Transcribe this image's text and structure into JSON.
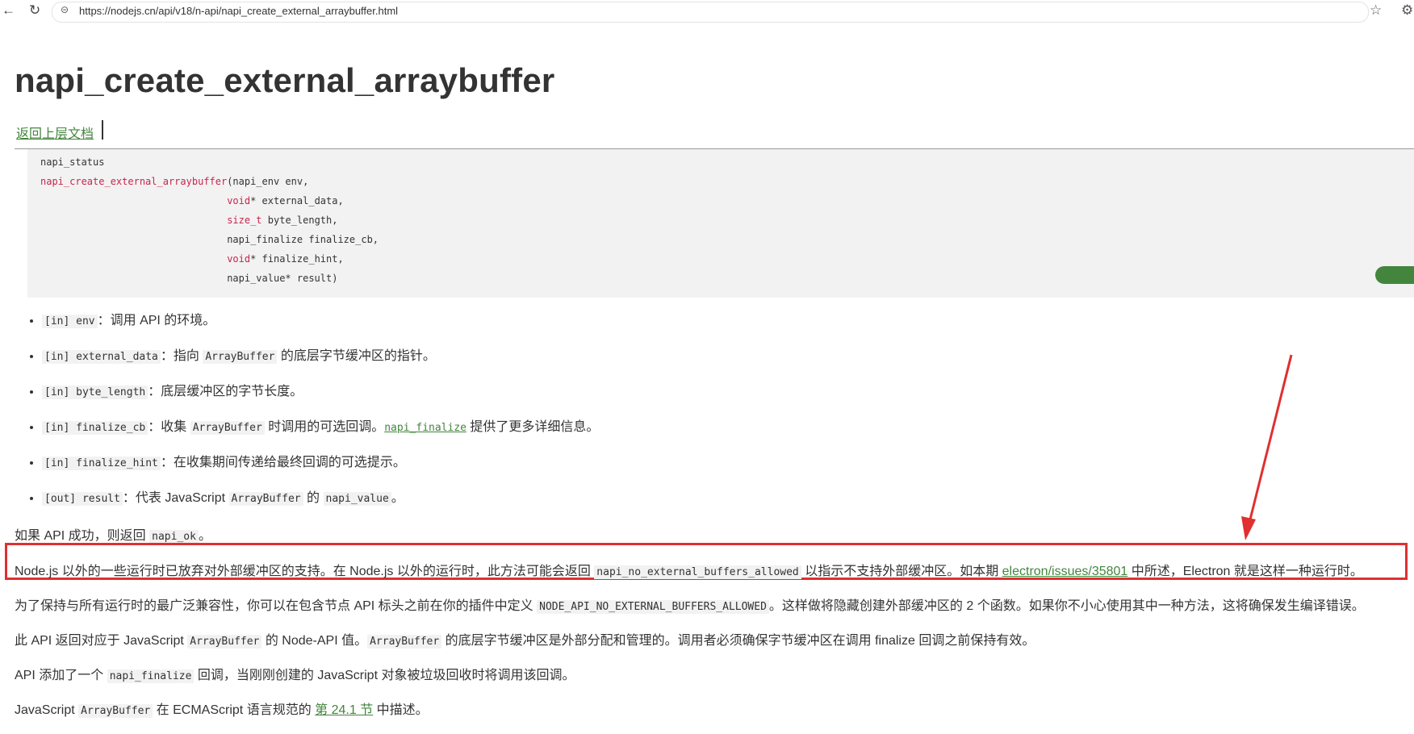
{
  "browser": {
    "url": "https://nodejs.cn/api/v18/n-api/napi_create_external_arraybuffer.html",
    "back_icon": "←",
    "reload_icon": "↻",
    "lock_icon": "⊝",
    "star_icon": "☆",
    "ext_icon": "⚙"
  },
  "page": {
    "title": "napi_create_external_arraybuffer",
    "back_link": "返回上层文档"
  },
  "code": {
    "l1": "napi_status",
    "l2_fn": "napi_create_external_arraybuffer",
    "l2_rest": "(napi_env env,",
    "l3_kw": "void",
    "l3_rest": "* external_data,",
    "l4_kw": "size_t",
    "l4_rest": " byte_length,",
    "l5": "napi_finalize finalize_cb,",
    "l6_kw": "void",
    "l6_rest": "* finalize_hint,",
    "l7": "napi_value* result)"
  },
  "params": [
    {
      "code": "[in] env",
      "text": "：调用 API 的环境。"
    },
    {
      "code": "[in] external_data",
      "text_a": "：指向 ",
      "code2": "ArrayBuffer",
      "text_b": " 的底层字节缓冲区的指针。"
    },
    {
      "code": "[in] byte_length",
      "text": "：底层缓冲区的字节长度。"
    },
    {
      "code": "[in] finalize_cb",
      "text_a": "：收集 ",
      "code2": "ArrayBuffer",
      "text_b": " 时调用的可选回调。",
      "link": "napi_finalize",
      "text_c": " 提供了更多详细信息。"
    },
    {
      "code": "[in] finalize_hint",
      "text": "：在收集期间传递给最终回调的可选提示。"
    },
    {
      "code": "[out] result",
      "text_a": "：代表 JavaScript ",
      "code2": "ArrayBuffer",
      "text_b": " 的 ",
      "code3": "napi_value",
      "text_c": "。"
    }
  ],
  "p1": {
    "a": "如果 API 成功，则返回 ",
    "code": "napi_ok",
    "b": "。"
  },
  "p2": {
    "a": "Node.js 以外的一些运行时已放弃对外部缓冲区的支持。在 Node.js 以外的运行时，此方法可能会返回 ",
    "code": "napi_no_external_buffers_allowed",
    "b": " 以指示不支持外部缓冲区。如本期 ",
    "link": "electron/issues/35801",
    "c": " 中所述，Electron 就是这样一种运行时。"
  },
  "p3": {
    "a": "为了保持与所有运行时的最广泛兼容性，你可以在包含节点 API 标头之前在你的插件中定义 ",
    "code": "NODE_API_NO_EXTERNAL_BUFFERS_ALLOWED",
    "b": "。这样做将隐藏创建外部缓冲区的 2 个函数。如果你不小心使用其中一种方法，这将确保发生编译错误。"
  },
  "p4": {
    "a": "此 API 返回对应于 JavaScript ",
    "code": "ArrayBuffer",
    "b": " 的 Node-API 值。",
    "code2": "ArrayBuffer",
    "c": " 的底层字节缓冲区是外部分配和管理的。调用者必须确保字节缓冲区在调用 finalize 回调之前保持有效。"
  },
  "p5": {
    "a": "API 添加了一个 ",
    "code": "napi_finalize",
    "b": " 回调，当刚刚创建的 JavaScript 对象被垃圾回收时将调用该回调。"
  },
  "p6": {
    "a": "JavaScript ",
    "code": "ArrayBuffer",
    "b": " 在 ECMAScript 语言规范的 ",
    "link": "第 24.1 节",
    "c": " 中描述。"
  },
  "colors": {
    "link": "#43853d",
    "annotation": "#e03030"
  }
}
